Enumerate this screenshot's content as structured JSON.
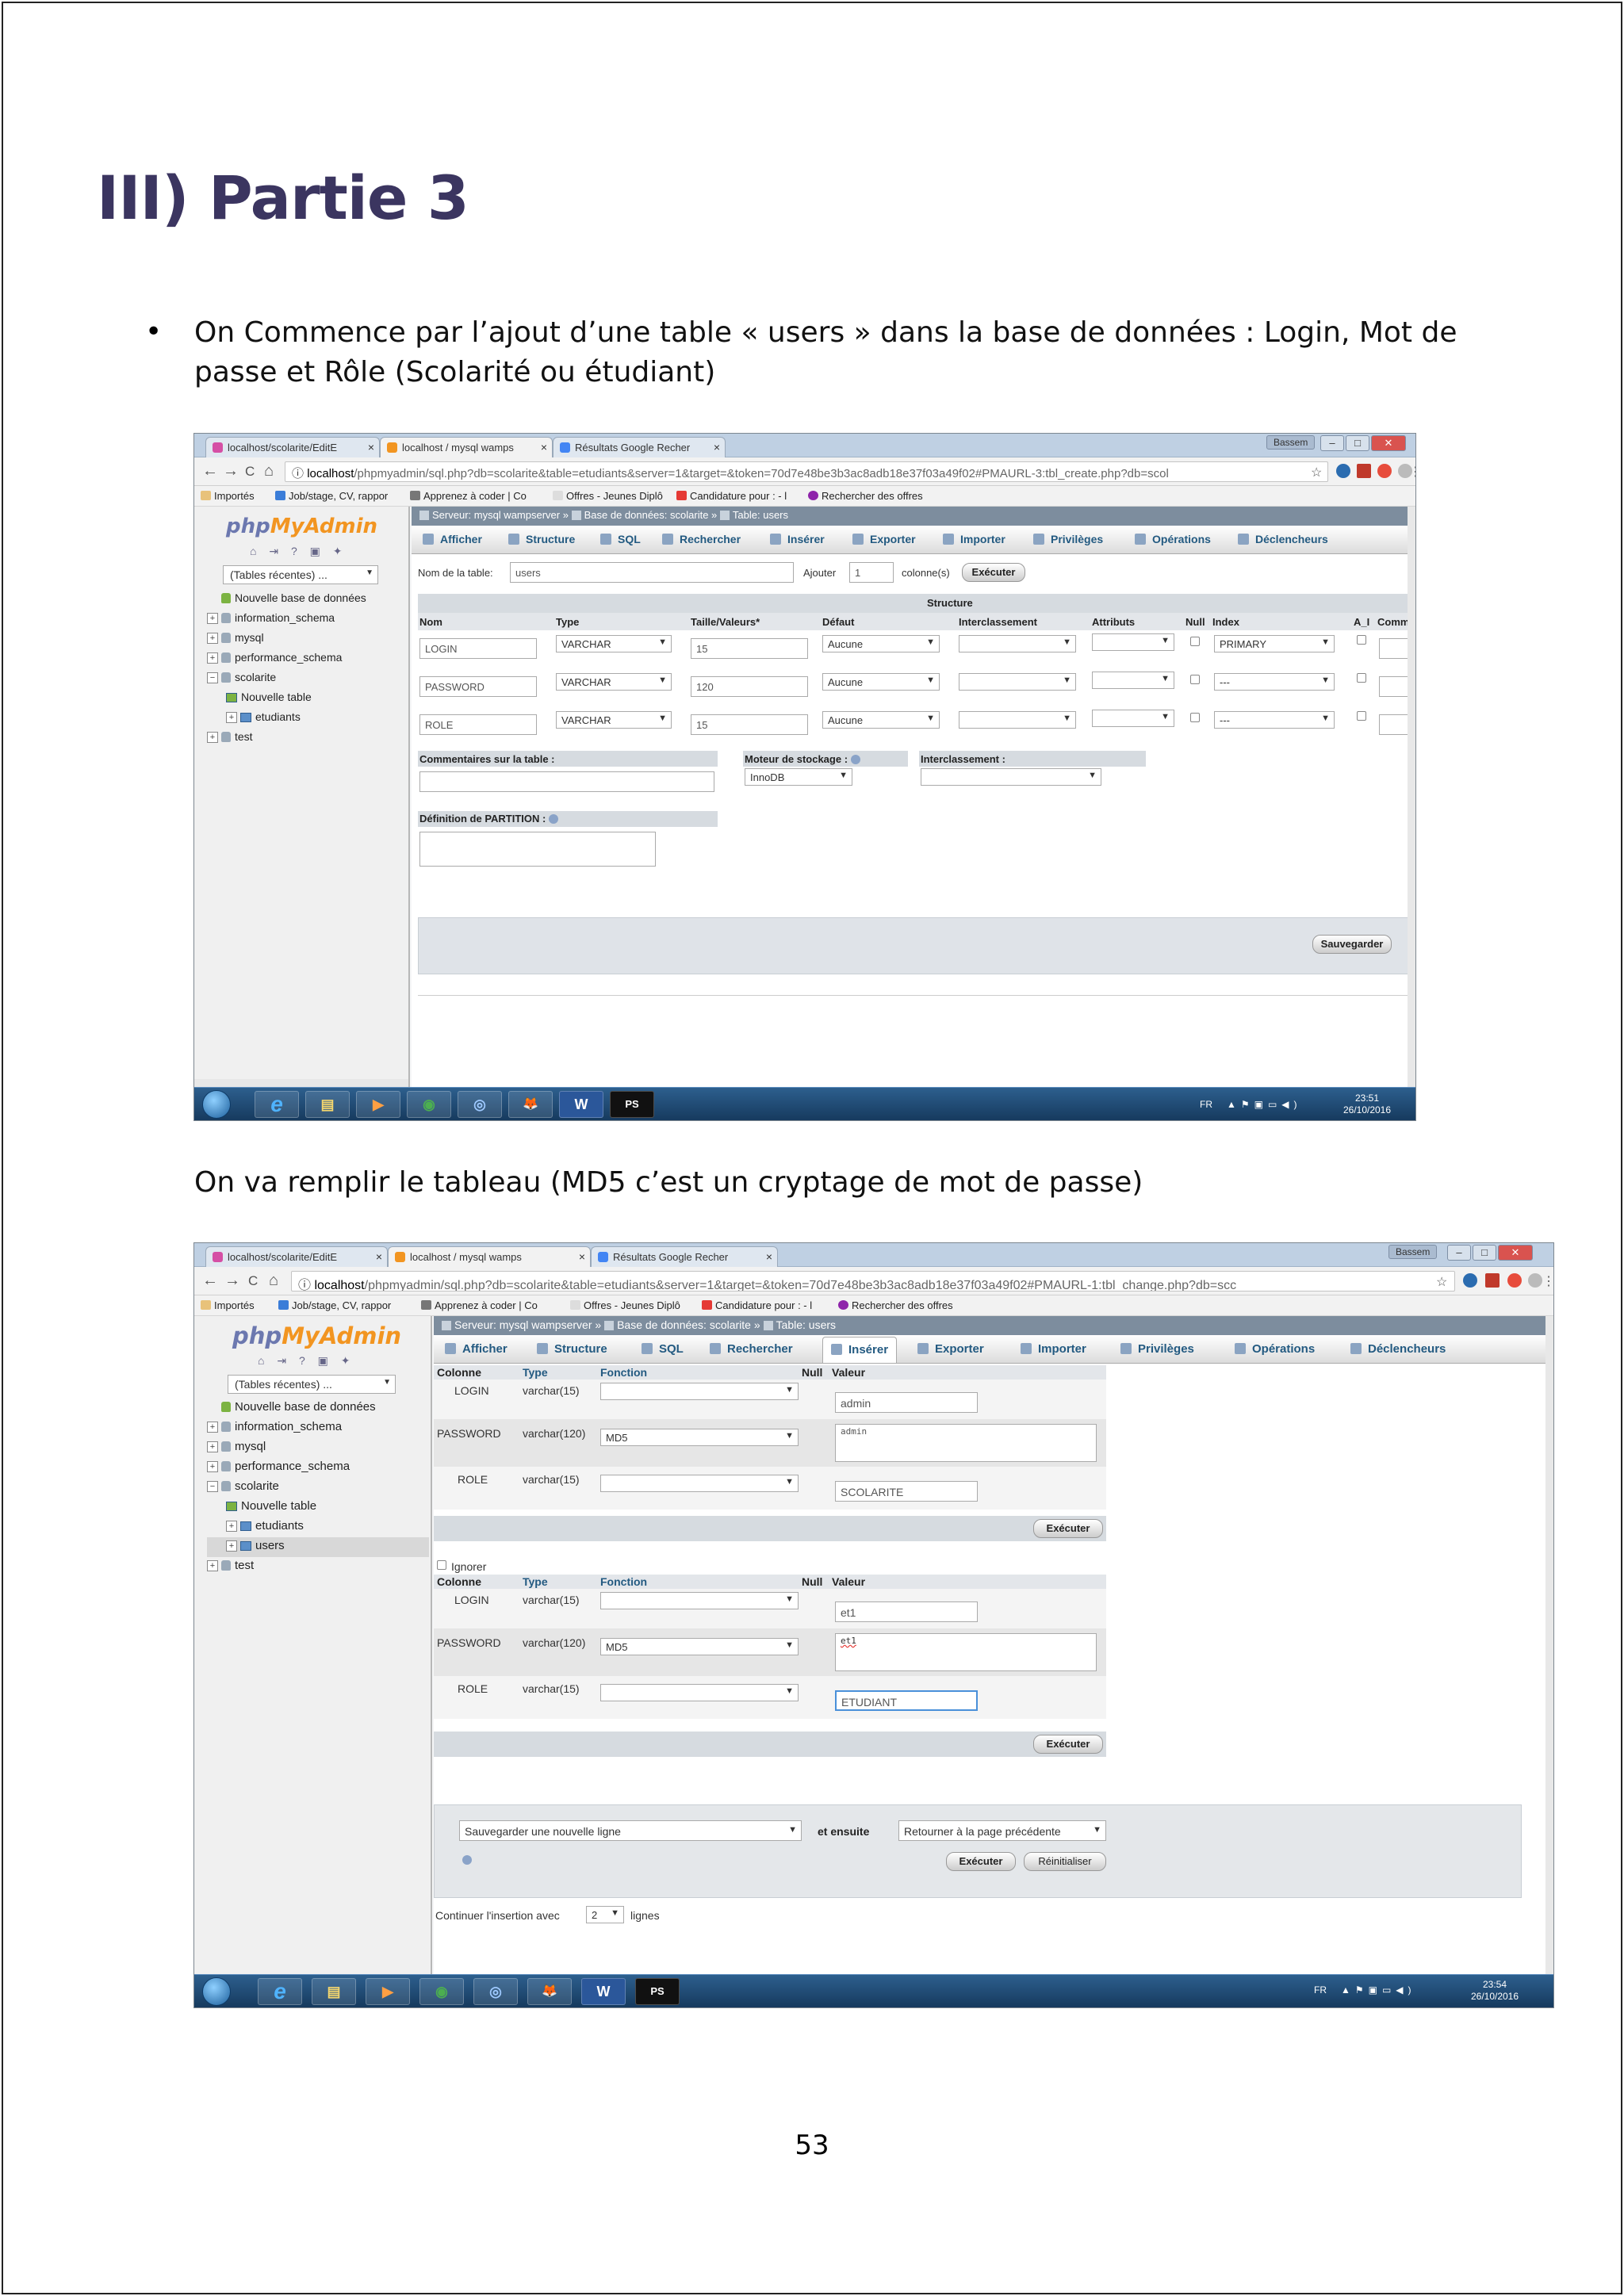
{
  "heading": "III) Partie 3",
  "intro": {
    "bullet": "•",
    "line1": "On Commence par l’ajout d’une table « users » dans la base de données : Login, Mot de",
    "line2": "passe et Rôle (Scolarité ou étudiant)"
  },
  "para2": "On va remplir le tableau (MD5 c’est un cryptage de mot de passe)",
  "page_number": "53",
  "shot1": {
    "tabs": [
      {
        "label": "localhost/scolarite/EditE",
        "close": "×"
      },
      {
        "label": "localhost / mysql wamps",
        "close": "×"
      },
      {
        "label": "Résultats Google Recher",
        "close": "×"
      }
    ],
    "window_user": "Bassem",
    "window_buttons": [
      "–",
      "□",
      "✕"
    ],
    "nav": {
      "back": "←",
      "forward": "→",
      "reload": "C",
      "home": "⌂",
      "info": "ⓘ",
      "star": "☆",
      "menu": "⋮"
    },
    "url_host": "localhost",
    "url_rest": "/phpmyadmin/sql.php?db=scolarite&table=etudiants&server=1&target=&token=70d7e48be3b3ac8adb18e37f03a49f02#PMAURL-3:tbl_create.php?db=scol",
    "bookmarks": [
      "Importés",
      "Job/stage, CV, rappor",
      "Apprenez à coder | Co",
      "Offres - Jeunes Diplô",
      "Candidature pour : - l",
      "Rechercher des offres"
    ],
    "logo": {
      "php": "php",
      "my": "My",
      "admin": "Admin"
    },
    "logo_icons": "⌂ ⇥ ? ▣ ✦",
    "recent_tables": "(Tables récentes) ...",
    "tree": [
      {
        "label": "Nouvelle base de données",
        "exp": "",
        "kind": "new"
      },
      {
        "label": "information_schema",
        "exp": "+",
        "kind": "db"
      },
      {
        "label": "mysql",
        "exp": "+",
        "kind": "db"
      },
      {
        "label": "performance_schema",
        "exp": "+",
        "kind": "db"
      },
      {
        "label": "scolarite",
        "exp": "−",
        "kind": "db"
      },
      {
        "label": "Nouvelle table",
        "exp": "",
        "kind": "newtbl"
      },
      {
        "label": "etudiants",
        "exp": "+",
        "kind": "tbl"
      },
      {
        "label": "test",
        "exp": "+",
        "kind": "db"
      }
    ],
    "breadcrumb": {
      "server": "Serveur: mysql wampserver",
      "db": "Base de données: scolarite",
      "table": "Table: users",
      "sep": "»"
    },
    "menu": [
      "Afficher",
      "Structure",
      "SQL",
      "Rechercher",
      "Insérer",
      "Exporter",
      "Importer",
      "Privilèges",
      "Opérations",
      "Déclencheurs"
    ],
    "form": {
      "table_name_label": "Nom de la table:",
      "table_name": "users",
      "add_label": "Ajouter",
      "add_count": "1",
      "columns_label": "colonne(s)",
      "execute": "Exécuter",
      "structure_title": "Structure",
      "headers": [
        "Nom",
        "Type",
        "Taille/Valeurs*",
        "Défaut",
        "Interclassement",
        "Attributs",
        "Null",
        "Index",
        "A_I",
        "Comm"
      ],
      "rows": [
        {
          "name": "LOGIN",
          "type": "VARCHAR",
          "size": "15",
          "default": "Aucune",
          "index": "PRIMARY"
        },
        {
          "name": "PASSWORD",
          "type": "VARCHAR",
          "size": "120",
          "default": "Aucune",
          "index": "---"
        },
        {
          "name": "ROLE",
          "type": "VARCHAR",
          "size": "15",
          "default": "Aucune",
          "index": "---"
        }
      ],
      "comments_label": "Commentaires sur la table :",
      "engine_label": "Moteur de stockage :",
      "engine": "InnoDB",
      "collation_label": "Interclassement :",
      "partition_label": "Définition de PARTITION :",
      "save": "Sauvegarder"
    },
    "taskbar": {
      "lang": "FR",
      "time": "23:51",
      "date": "26/10/2016",
      "items": [
        "e",
        "▤",
        "▶",
        "◉",
        "◎",
        "🦊",
        "W",
        "PS"
      ]
    }
  },
  "shot2": {
    "tabs": [
      {
        "label": "localhost/scolarite/EditE",
        "close": "×"
      },
      {
        "label": "localhost / mysql wamps",
        "close": "×"
      },
      {
        "label": "Résultats Google Recher",
        "close": "×"
      }
    ],
    "window_user": "Bassem",
    "window_buttons": [
      "–",
      "□",
      "✕"
    ],
    "nav": {
      "back": "←",
      "forward": "→",
      "reload": "C",
      "home": "⌂",
      "info": "ⓘ",
      "star": "☆",
      "menu": "⋮"
    },
    "url_host": "localhost",
    "url_rest": "/phpmyadmin/sql.php?db=scolarite&table=etudiants&server=1&target=&token=70d7e48be3b3ac8adb18e37f03a49f02#PMAURL-1:tbl_change.php?db=scc",
    "bookmarks": [
      "Importés",
      "Job/stage, CV, rappor",
      "Apprenez à coder | Co",
      "Offres - Jeunes Diplô",
      "Candidature pour : - l",
      "Rechercher des offres"
    ],
    "logo": {
      "php": "php",
      "my": "My",
      "admin": "Admin"
    },
    "logo_icons": "⌂ ⇥ ? ▣ ✦",
    "recent_tables": "(Tables récentes) ...",
    "tree": [
      {
        "label": "Nouvelle base de données",
        "exp": "",
        "kind": "new"
      },
      {
        "label": "information_schema",
        "exp": "+",
        "kind": "db"
      },
      {
        "label": "mysql",
        "exp": "+",
        "kind": "db"
      },
      {
        "label": "performance_schema",
        "exp": "+",
        "kind": "db"
      },
      {
        "label": "scolarite",
        "exp": "−",
        "kind": "db"
      },
      {
        "label": "Nouvelle table",
        "exp": "",
        "kind": "newtbl"
      },
      {
        "label": "etudiants",
        "exp": "+",
        "kind": "tbl"
      },
      {
        "label": "users",
        "exp": "+",
        "kind": "tbl"
      },
      {
        "label": "test",
        "exp": "+",
        "kind": "db"
      }
    ],
    "breadcrumb": {
      "server": "Serveur: mysql wampserver",
      "db": "Base de données: scolarite",
      "table": "Table: users",
      "sep": "»"
    },
    "menu": [
      "Afficher",
      "Structure",
      "SQL",
      "Rechercher",
      "Insérer",
      "Exporter",
      "Importer",
      "Privilèges",
      "Opérations",
      "Déclencheurs"
    ],
    "headers": [
      "Colonne",
      "Type",
      "Fonction",
      "Null",
      "Valeur"
    ],
    "insert1": [
      {
        "col": "LOGIN",
        "type": "varchar(15)",
        "func": "",
        "value": "admin"
      },
      {
        "col": "PASSWORD",
        "type": "varchar(120)",
        "func": "MD5",
        "value": "admin"
      },
      {
        "col": "ROLE",
        "type": "varchar(15)",
        "func": "",
        "value": "SCOLARITE"
      }
    ],
    "ignore_label": "Ignorer",
    "insert2": [
      {
        "col": "LOGIN",
        "type": "varchar(15)",
        "func": "",
        "value": "et1"
      },
      {
        "col": "PASSWORD",
        "type": "varchar(120)",
        "func": "MD5",
        "value": "et1"
      },
      {
        "col": "ROLE",
        "type": "varchar(15)",
        "func": "",
        "value": "ETUDIANT"
      }
    ],
    "execute": "Exécuter",
    "footer": {
      "save_new": "Sauvegarder une nouvelle ligne",
      "then": "et ensuite",
      "return": "Retourner à la page précédente",
      "execute": "Exécuter",
      "reset": "Réinitialiser",
      "continue_label": "Continuer l'insertion avec",
      "continue_count": "2",
      "lines": "lignes"
    },
    "taskbar": {
      "lang": "FR",
      "time": "23:54",
      "date": "26/10/2016",
      "items": [
        "e",
        "▤",
        "▶",
        "◉",
        "◎",
        "🦊",
        "W",
        "PS"
      ]
    }
  },
  "colors": {
    "heading": "#3b3560",
    "pma_blue": "#6c78af",
    "pma_orange": "#f29521",
    "link": "#235a81"
  }
}
